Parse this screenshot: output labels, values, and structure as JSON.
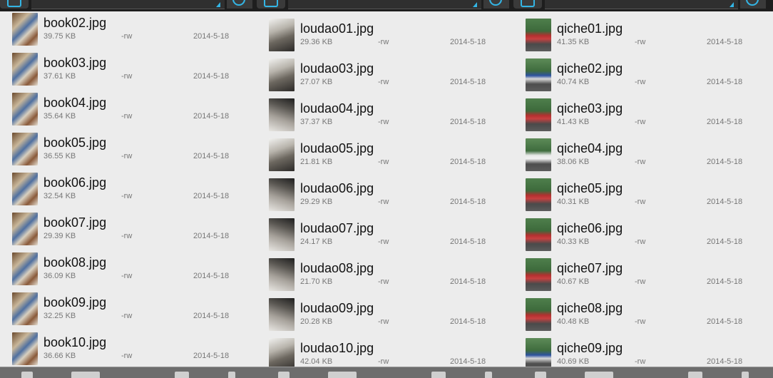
{
  "panes": [
    {
      "files": [
        {
          "name": "book02.jpg",
          "size": "39.75 KB",
          "perm": "-rw",
          "date": "2014-5-18",
          "thumb": "t-book"
        },
        {
          "name": "book03.jpg",
          "size": "37.61 KB",
          "perm": "-rw",
          "date": "2014-5-18",
          "thumb": "t-book"
        },
        {
          "name": "book04.jpg",
          "size": "35.64 KB",
          "perm": "-rw",
          "date": "2014-5-18",
          "thumb": "t-book"
        },
        {
          "name": "book05.jpg",
          "size": "36.55 KB",
          "perm": "-rw",
          "date": "2014-5-18",
          "thumb": "t-book"
        },
        {
          "name": "book06.jpg",
          "size": "32.54 KB",
          "perm": "-rw",
          "date": "2014-5-18",
          "thumb": "t-book"
        },
        {
          "name": "book07.jpg",
          "size": "29.39 KB",
          "perm": "-rw",
          "date": "2014-5-18",
          "thumb": "t-book"
        },
        {
          "name": "book08.jpg",
          "size": "36.09 KB",
          "perm": "-rw",
          "date": "2014-5-18",
          "thumb": "t-book"
        },
        {
          "name": "book09.jpg",
          "size": "32.25 KB",
          "perm": "-rw",
          "date": "2014-5-18",
          "thumb": "t-book"
        },
        {
          "name": "book10.jpg",
          "size": "36.66 KB",
          "perm": "-rw",
          "date": "2014-5-18",
          "thumb": "t-book"
        }
      ]
    },
    {
      "files": [
        {
          "name": "loudao01.jpg",
          "size": "29.36 KB",
          "perm": "-rw",
          "date": "2014-5-18",
          "thumb": "t-lou-a"
        },
        {
          "name": "loudao03.jpg",
          "size": "27.07 KB",
          "perm": "-rw",
          "date": "2014-5-18",
          "thumb": "t-lou-a"
        },
        {
          "name": "loudao04.jpg",
          "size": "37.37 KB",
          "perm": "-rw",
          "date": "2014-5-18",
          "thumb": "t-lou-b"
        },
        {
          "name": "loudao05.jpg",
          "size": "21.81 KB",
          "perm": "-rw",
          "date": "2014-5-18",
          "thumb": "t-lou-a"
        },
        {
          "name": "loudao06.jpg",
          "size": "29.29 KB",
          "perm": "-rw",
          "date": "2014-5-18",
          "thumb": "t-lou-b"
        },
        {
          "name": "loudao07.jpg",
          "size": "24.17 KB",
          "perm": "-rw",
          "date": "2014-5-18",
          "thumb": "t-lou-b"
        },
        {
          "name": "loudao08.jpg",
          "size": "21.70 KB",
          "perm": "-rw",
          "date": "2014-5-18",
          "thumb": "t-lou-b"
        },
        {
          "name": "loudao09.jpg",
          "size": "20.28 KB",
          "perm": "-rw",
          "date": "2014-5-18",
          "thumb": "t-lou-b"
        },
        {
          "name": "loudao10.jpg",
          "size": "42.04 KB",
          "perm": "-rw",
          "date": "2014-5-18",
          "thumb": "t-lou-a"
        }
      ]
    },
    {
      "files": [
        {
          "name": "qiche01.jpg",
          "size": "41.35 KB",
          "perm": "-rw",
          "date": "2014-5-18",
          "thumb": "t-qi-a"
        },
        {
          "name": "qiche02.jpg",
          "size": "40.74 KB",
          "perm": "-rw",
          "date": "2014-5-18",
          "thumb": "t-qi-b"
        },
        {
          "name": "qiche03.jpg",
          "size": "41.43 KB",
          "perm": "-rw",
          "date": "2014-5-18",
          "thumb": "t-qi-a"
        },
        {
          "name": "qiche04.jpg",
          "size": "38.06 KB",
          "perm": "-rw",
          "date": "2014-5-18",
          "thumb": "t-qi-c"
        },
        {
          "name": "qiche05.jpg",
          "size": "40.31 KB",
          "perm": "-rw",
          "date": "2014-5-18",
          "thumb": "t-qi-a"
        },
        {
          "name": "qiche06.jpg",
          "size": "40.33 KB",
          "perm": "-rw",
          "date": "2014-5-18",
          "thumb": "t-qi-a"
        },
        {
          "name": "qiche07.jpg",
          "size": "40.67 KB",
          "perm": "-rw",
          "date": "2014-5-18",
          "thumb": "t-qi-a"
        },
        {
          "name": "qiche08.jpg",
          "size": "40.48 KB",
          "perm": "-rw",
          "date": "2014-5-18",
          "thumb": "t-qi-a"
        },
        {
          "name": "qiche09.jpg",
          "size": "40.69 KB",
          "perm": "-rw",
          "date": "2014-5-18",
          "thumb": "t-qi-b"
        }
      ]
    }
  ],
  "toolbar": {
    "icons": [
      "folder-icon",
      "path-dropdown",
      "refresh-icon"
    ],
    "accent": "#33b5e5"
  }
}
